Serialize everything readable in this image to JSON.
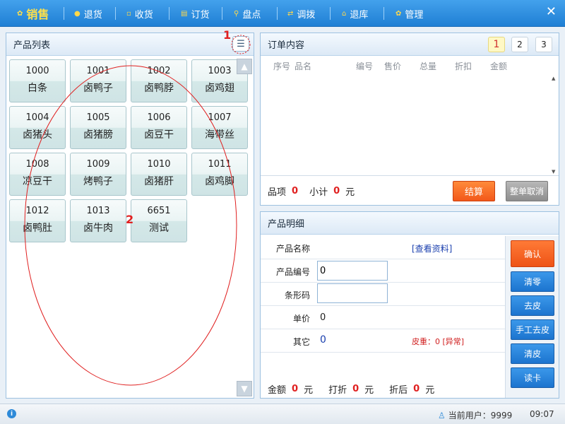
{
  "nav": {
    "items": [
      {
        "label": "销售",
        "icon": "gear-icon"
      },
      {
        "label": "退货",
        "icon": "dot-icon"
      },
      {
        "label": "收货",
        "icon": "document-icon"
      },
      {
        "label": "订货",
        "icon": "chat-icon"
      },
      {
        "label": "盘点",
        "icon": "search-icon"
      },
      {
        "label": "调拨",
        "icon": "arrows-icon"
      },
      {
        "label": "退库",
        "icon": "home-icon"
      },
      {
        "label": "管理",
        "icon": "gear-icon"
      }
    ],
    "close": "✕"
  },
  "product_list": {
    "title": "产品列表",
    "menu_icon": "☰",
    "annotation_1": "1",
    "annotation_2": "2",
    "products": [
      {
        "code": "1000",
        "name": "白条"
      },
      {
        "code": "1001",
        "name": "卤鸭子"
      },
      {
        "code": "1002",
        "name": "卤鸭脖"
      },
      {
        "code": "1003",
        "name": "卤鸡翅"
      },
      {
        "code": "1004",
        "name": "卤猪头"
      },
      {
        "code": "1005",
        "name": "卤猪膀"
      },
      {
        "code": "1006",
        "name": "卤豆干"
      },
      {
        "code": "1007",
        "name": "海带丝"
      },
      {
        "code": "1008",
        "name": "凉豆干"
      },
      {
        "code": "1009",
        "name": "烤鸭子"
      },
      {
        "code": "1010",
        "name": "卤猪肝"
      },
      {
        "code": "1011",
        "name": "卤鸡脚"
      },
      {
        "code": "1012",
        "name": "卤鸭肚"
      },
      {
        "code": "1013",
        "name": "卤牛肉"
      },
      {
        "code": "6651",
        "name": "测试"
      }
    ]
  },
  "order": {
    "title": "订单内容",
    "pages": [
      "1",
      "2",
      "3"
    ],
    "columns": [
      "序号",
      "品名",
      "编号",
      "售价",
      "总量",
      "折扣",
      "金额"
    ],
    "items_label": "品项",
    "items_count": "0",
    "subtotal_label": "小计",
    "subtotal_value": "0",
    "currency": "元",
    "checkout": "结算",
    "cancel_all": "整单取消"
  },
  "detail": {
    "title": "产品明细",
    "name_label": "产品名称",
    "view_link": "[查看资料]",
    "code_label": "产品编号",
    "code_value": "0",
    "barcode_label": "条形码",
    "barcode_value": "",
    "price_label": "单价",
    "price_value": "0",
    "other_label": "其它",
    "other_value": "0",
    "tare_text": "皮重：0 [异常]",
    "amount_label": "金额",
    "amount_value": "0",
    "discount_label": "打折",
    "discount_value": "0",
    "after_label": "折后",
    "after_value": "0",
    "currency": "元",
    "buttons": [
      "确认",
      "清零",
      "去皮",
      "手工去皮",
      "清皮",
      "读卡"
    ]
  },
  "status": {
    "user_label": "当前用户：9999",
    "time": "09:07"
  },
  "colors": {
    "nav_bg": "#2a8fe0",
    "active_nav": "#ffe04a",
    "accent_red": "#e02020",
    "orange_btn": "#f2581a",
    "blue_btn": "#1c74cf"
  }
}
